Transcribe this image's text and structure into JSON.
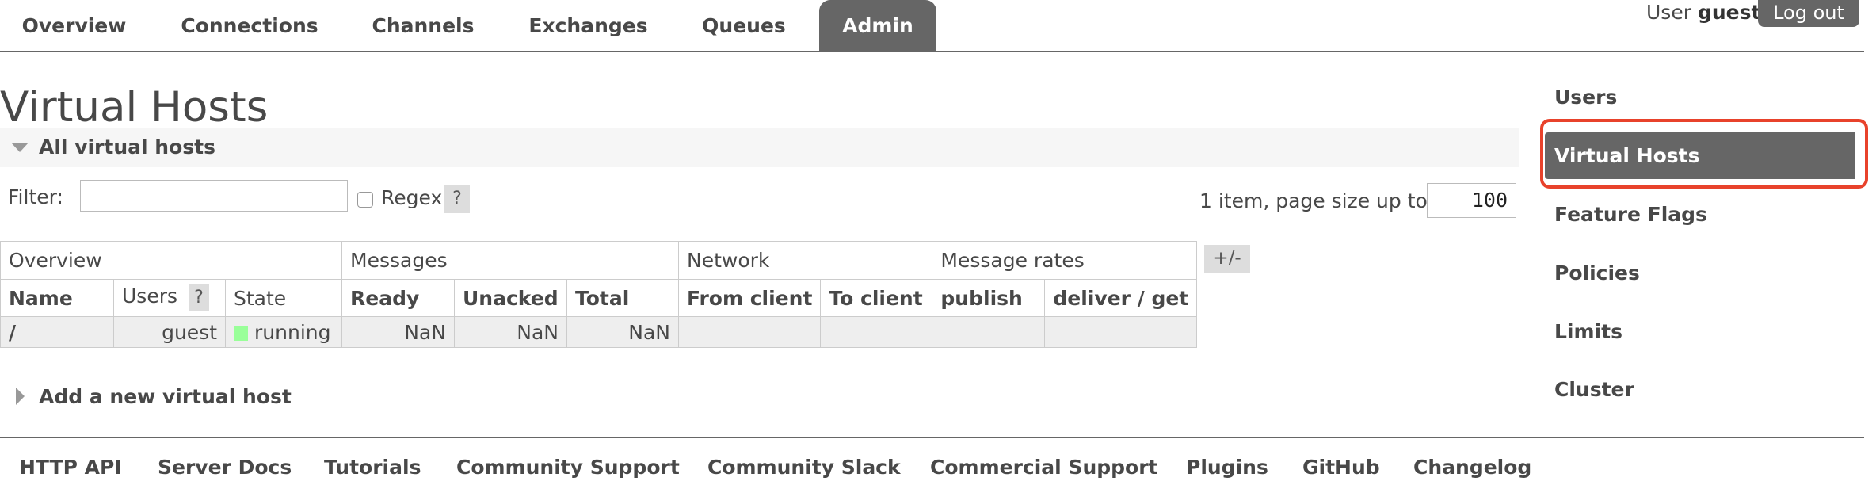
{
  "nav": {
    "tabs": [
      {
        "label": "Overview"
      },
      {
        "label": "Connections"
      },
      {
        "label": "Channels"
      },
      {
        "label": "Exchanges"
      },
      {
        "label": "Queues"
      },
      {
        "label": "Admin",
        "active": true
      }
    ],
    "user_prefix": "User",
    "user_name": "guest",
    "logout_label": "Log out"
  },
  "page": {
    "title": "Virtual Hosts",
    "section_title": "All virtual hosts",
    "filter": {
      "label": "Filter:",
      "value": "",
      "regex_label": "Regex",
      "regex_checked": false,
      "help": "?"
    },
    "paging": {
      "text": "1 item, page size up to",
      "page_size": "100"
    },
    "table": {
      "groups": [
        "Overview",
        "Messages",
        "Network",
        "Message rates"
      ],
      "columns": [
        "Name",
        "Users",
        "State",
        "Ready",
        "Unacked",
        "Total",
        "From client",
        "To client",
        "publish",
        "deliver / get"
      ],
      "users_help": "?",
      "rows": [
        {
          "name": "/",
          "users": "guest",
          "state": "running",
          "ready": "NaN",
          "unacked": "NaN",
          "total": "NaN",
          "from_client": "",
          "to_client": "",
          "publish": "",
          "deliver_get": ""
        }
      ],
      "toggle_columns": "+/-"
    },
    "add_section": "Add a new virtual host"
  },
  "sidemenu": {
    "items": [
      {
        "label": "Users"
      },
      {
        "label": "Virtual Hosts",
        "active": true
      },
      {
        "label": "Feature Flags"
      },
      {
        "label": "Policies"
      },
      {
        "label": "Limits"
      },
      {
        "label": "Cluster"
      }
    ]
  },
  "footer": {
    "links": [
      "HTTP API",
      "Server Docs",
      "Tutorials",
      "Community Support",
      "Community Slack",
      "Commercial Support",
      "Plugins",
      "GitHub",
      "Changelog"
    ]
  },
  "colors": {
    "nav_active": "#666666",
    "running_indicator": "#99ff99",
    "highlight": "#e8422b"
  }
}
